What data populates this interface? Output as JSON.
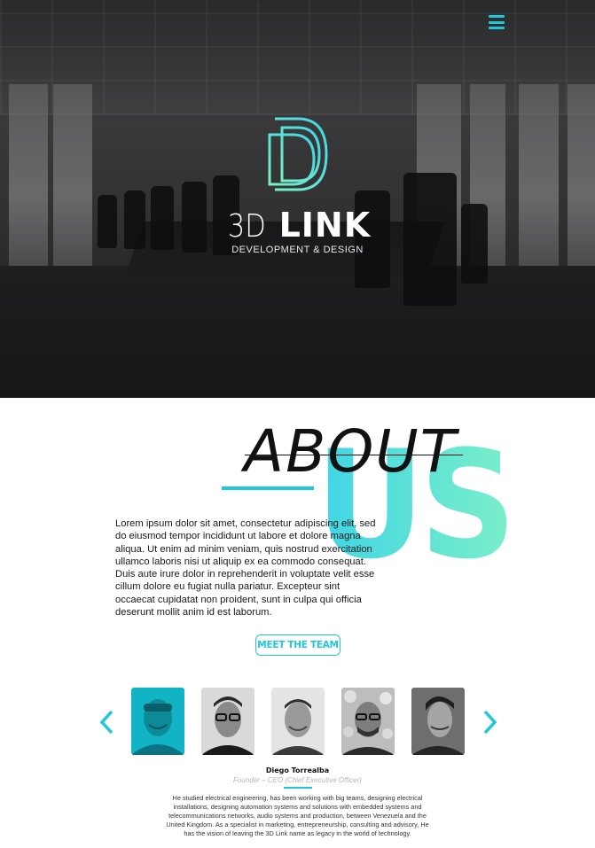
{
  "hero": {
    "brand_light": "3D",
    "brand_bold": "LINK",
    "tagline": "DEVELOPMENT & DESIGN"
  },
  "about": {
    "title": "ABOUT",
    "title_highlight": "US",
    "body": "Lorem ipsum dolor sit amet, consectetur adipiscing elit, sed do eiusmod tempor incididunt ut labore et dolore magna aliqua. Ut enim ad minim veniam, quis nostrud exercitation ullamco laboris nisi ut aliquip ex ea commodo consequat. Duis aute irure dolor in reprehenderit in voluptate velit esse cillum dolore eu fugiat nulla pariatur. Excepteur sint occaecat cupidatat non proident, sunt in culpa qui officia deserunt mollit anim id est laborum.",
    "button_label": "MEET THE TEAM"
  },
  "team": {
    "selected": {
      "name": "Diego Torrealba",
      "role": "Founder – CEO (Chief Executive Officer)",
      "bio": "He studied electrical engineering, has been working with big teams, designing electrical installations, designing automation systems and solutions with embedded systems and telecommunications networks, audio systems and production, between Venezuela and the United Kingdom.  As a specialist in marketing, entrepreneurship, consulting and advisory, He has the vision of leaving the 3D Link name as legacy in the world of technology."
    },
    "members_count": 5
  },
  "colors": {
    "accent": "#1ec8dc",
    "gradient_start": "#3fd4e6",
    "gradient_end": "#7aefc8"
  },
  "icons": {
    "menu": "hamburger-menu-icon",
    "prev": "chevron-left-icon",
    "next": "chevron-right-icon"
  }
}
